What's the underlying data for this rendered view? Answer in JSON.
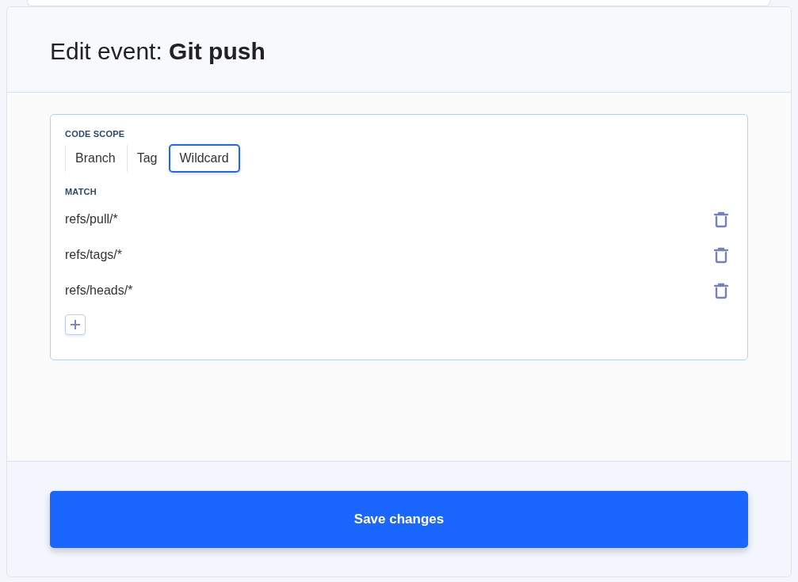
{
  "title": "Edit event: **Git push**",
  "scope": {
    "label": "CODE SCOPE",
    "tabs": [
      {
        "label": "Branch",
        "selected": false
      },
      {
        "label": "Tag",
        "selected": false
      },
      {
        "label": "Wildcard",
        "selected": true
      }
    ]
  },
  "match": {
    "label": "MATCH",
    "patterns": [
      "refs/pull/*",
      "refs/tags/*",
      "refs/heads/*"
    ]
  },
  "save_button": "Save changes"
}
